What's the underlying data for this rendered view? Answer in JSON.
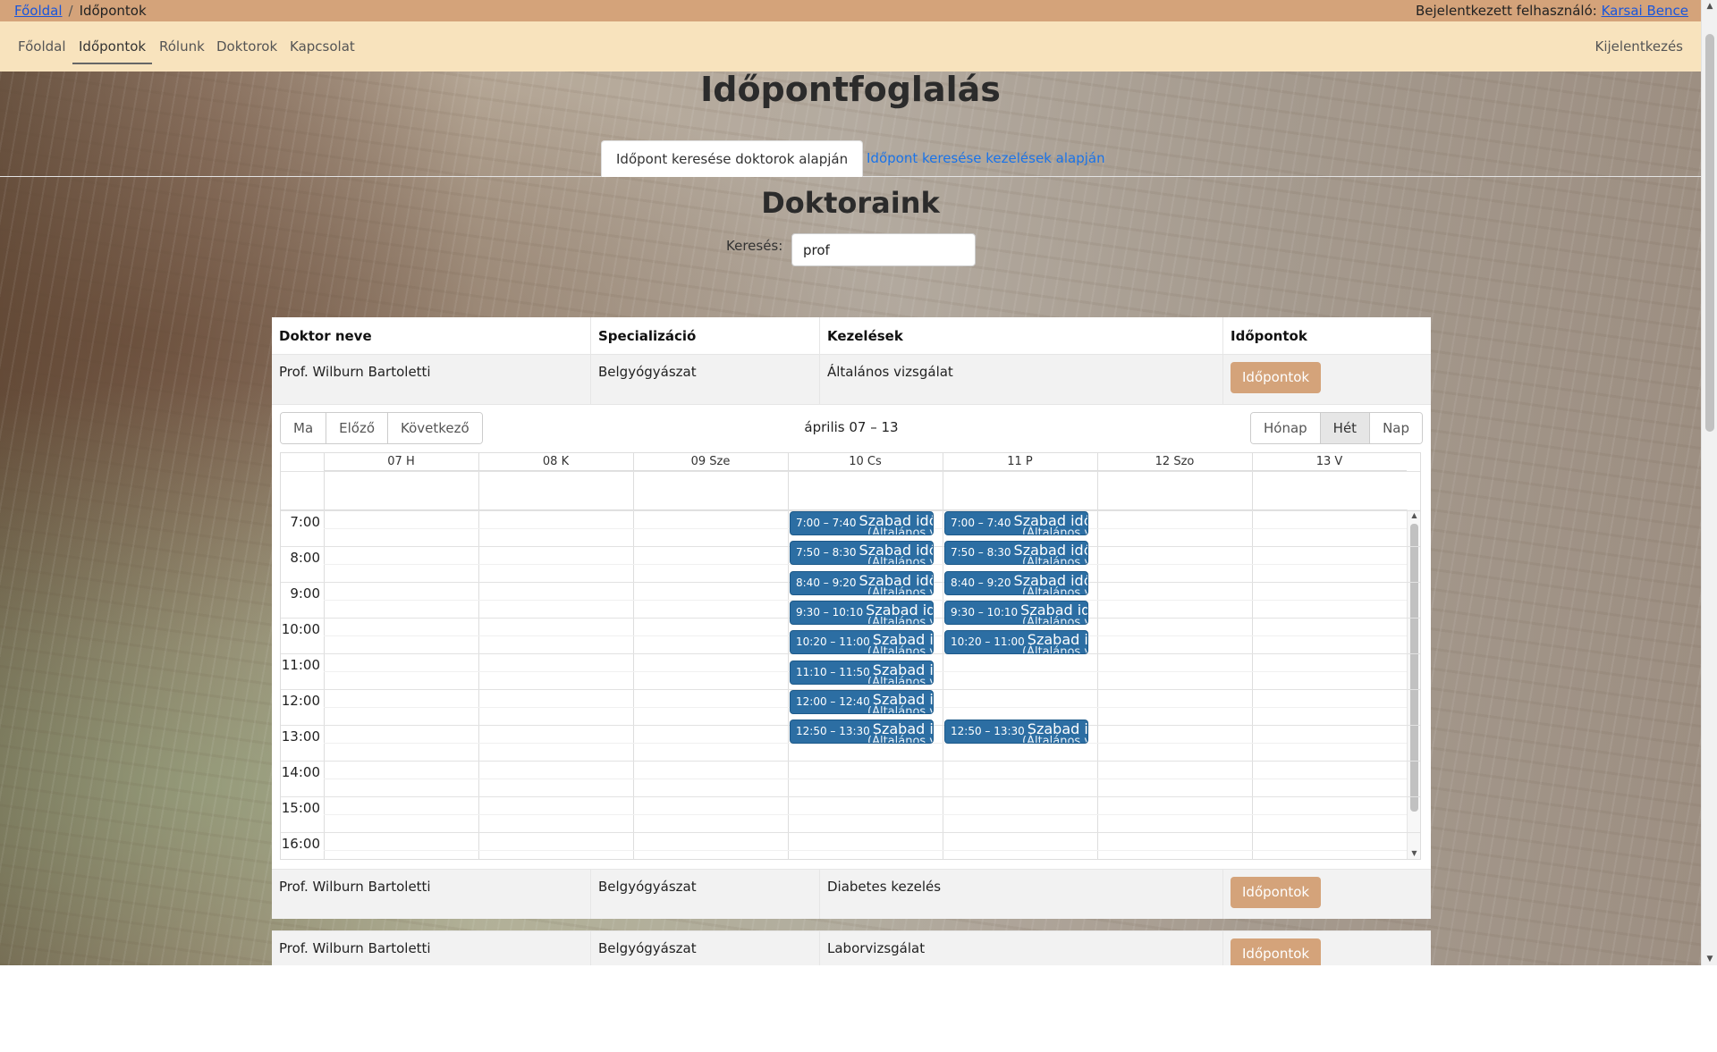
{
  "breadcrumb": {
    "home": "Főoldal",
    "separator": "/",
    "current": "Időpontok"
  },
  "user": {
    "label": "Bejelentkezett felhasználó:",
    "name": "Karsai Bence"
  },
  "nav": {
    "items": [
      "Főoldal",
      "Időpontok",
      "Rólunk",
      "Doktorok",
      "Kapcsolat"
    ],
    "active": "Időpontok",
    "logout": "Kijelentkezés"
  },
  "page_title": "Időpontfoglalás",
  "tabs": {
    "doctors": "Időpont keresése doktorok alapján",
    "treatments": "Időpont keresése kezelések alapján"
  },
  "section_title": "Doktoraink",
  "search": {
    "label": "Keresés:",
    "value": "prof"
  },
  "table": {
    "headers": [
      "Doktor neve",
      "Specializáció",
      "Kezelések",
      "Időpontok"
    ],
    "rows": [
      {
        "name": "Prof. Wilburn Bartoletti",
        "spec": "Belgyógyászat",
        "treatment": "Általános vizsgálat",
        "button": "Időpontok"
      },
      {
        "name": "Prof. Wilburn Bartoletti",
        "spec": "Belgyógyászat",
        "treatment": "Diabetes kezelés",
        "button": "Időpontok"
      },
      {
        "name": "Prof. Wilburn Bartoletti",
        "spec": "Belgyógyászat",
        "treatment": "Laborvizsgálat",
        "button": "Időpontok"
      }
    ]
  },
  "calendar": {
    "nav_buttons": [
      "Ma",
      "Előző",
      "Következő"
    ],
    "title": "április 07 – 13",
    "view_buttons": [
      "Hónap",
      "Hét",
      "Nap"
    ],
    "active_view": "Hét",
    "days": [
      "07 H",
      "08 K",
      "09 Sze",
      "10 Cs",
      "11 P",
      "12 Szo",
      "13 V"
    ],
    "hours": [
      "7:00",
      "8:00",
      "9:00",
      "10:00",
      "11:00",
      "12:00",
      "13:00",
      "14:00",
      "15:00",
      "16:00"
    ],
    "event_title": "Szabad időpont",
    "event_subtitle": "(Általános vizsgálat)",
    "events": [
      {
        "day": 3,
        "time": "7:00 – 7:40",
        "start": 7.0
      },
      {
        "day": 3,
        "time": "7:50 – 8:30",
        "start": 7.833
      },
      {
        "day": 3,
        "time": "8:40 – 9:20",
        "start": 8.667
      },
      {
        "day": 3,
        "time": "9:30 – 10:10",
        "start": 9.5
      },
      {
        "day": 3,
        "time": "10:20 – 11:00",
        "start": 10.333
      },
      {
        "day": 3,
        "time": "11:10 – 11:50",
        "start": 11.167
      },
      {
        "day": 3,
        "time": "12:00 – 12:40",
        "start": 12.0
      },
      {
        "day": 3,
        "time": "12:50 – 13:30",
        "start": 12.833
      },
      {
        "day": 4,
        "time": "7:00 – 7:40",
        "start": 7.0
      },
      {
        "day": 4,
        "time": "7:50 – 8:30",
        "start": 7.833
      },
      {
        "day": 4,
        "time": "8:40 – 9:20",
        "start": 8.667
      },
      {
        "day": 4,
        "time": "9:30 – 10:10",
        "start": 9.5
      },
      {
        "day": 4,
        "time": "10:20 – 11:00",
        "start": 10.333
      },
      {
        "day": 4,
        "time": "12:50 – 13:30",
        "start": 12.833
      }
    ]
  },
  "colors": {
    "topbar": "#d4a37a",
    "navbar": "#f8e3bd",
    "accent_button": "#d4a37a",
    "event": "#2c6ea3",
    "link": "#1a56db"
  }
}
